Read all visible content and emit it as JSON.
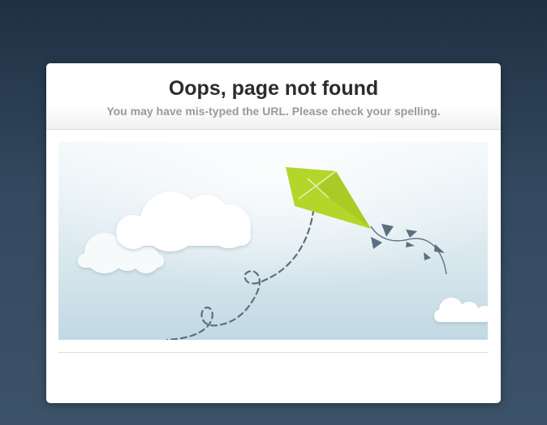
{
  "error_page": {
    "title": "Oops, page not found",
    "subtitle": "You may have mis-typed the URL. Please check your spelling."
  },
  "colors": {
    "background_top": "#1f3043",
    "background_bottom": "#3b5268",
    "kite": "#b3d62a",
    "kite_string": "#5b6f80",
    "sky_top": "#f4f9fb",
    "sky_bottom": "#c1d9e3"
  },
  "illustration": {
    "icons": [
      "cloud-icon",
      "kite-icon",
      "kite-tail-icon",
      "kite-string-icon"
    ]
  }
}
